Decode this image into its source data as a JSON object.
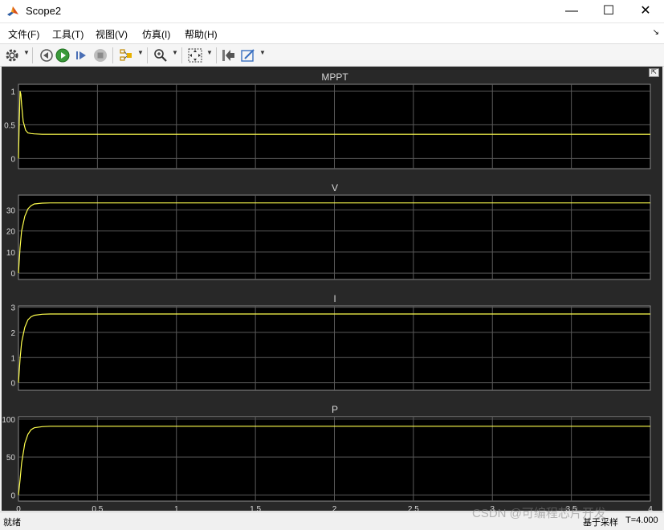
{
  "window": {
    "title": "Scope2",
    "minimize_glyph": "—",
    "maximize_glyph": "☐",
    "close_glyph": "✕"
  },
  "menu": {
    "items": [
      "文件(F)",
      "工具(T)",
      "视图(V)",
      "仿真(I)",
      "帮助(H)"
    ],
    "overflow_glyph": "↘"
  },
  "toolbar": {
    "icons": [
      "settings-icon",
      "step-back-icon",
      "run-icon",
      "step-forward-icon",
      "stop-icon",
      "signal-selector-icon",
      "zoom-icon",
      "autoscale-icon",
      "highlight-block-icon",
      "style-icon"
    ]
  },
  "plots": [
    {
      "title": "MPPT",
      "ylim": [
        -0.15,
        1.1
      ],
      "yticks": [
        "0",
        "0.5",
        "1"
      ],
      "ytick_values": [
        0,
        0.5,
        1
      ]
    },
    {
      "title": "V",
      "ylim": [
        -3,
        37
      ],
      "yticks": [
        "0",
        "10",
        "20",
        "30"
      ],
      "ytick_values": [
        0,
        10,
        20,
        30
      ]
    },
    {
      "title": "I",
      "ylim": [
        -0.3,
        3.05
      ],
      "yticks": [
        "0",
        "1",
        "2",
        "3"
      ],
      "ytick_values": [
        0,
        1,
        2,
        3
      ]
    },
    {
      "title": "P",
      "ylim": [
        -8,
        103
      ],
      "yticks": [
        "0",
        "50",
        "100"
      ],
      "ytick_values": [
        0,
        50,
        100
      ]
    }
  ],
  "xaxis": {
    "xlim": [
      0,
      4
    ],
    "ticks": [
      "0",
      "0.5",
      "1",
      "1.5",
      "2",
      "2.5",
      "3",
      "3.5",
      "4"
    ],
    "tick_values": [
      0,
      0.5,
      1,
      1.5,
      2,
      2.5,
      3,
      3.5,
      4
    ]
  },
  "chart_data": [
    {
      "type": "line",
      "title": "MPPT",
      "series": [
        {
          "x": [
            0,
            0.005,
            0.01,
            0.015,
            0.02,
            0.03,
            0.045,
            0.06,
            0.08,
            0.1,
            0.15,
            0.3,
            1,
            2,
            3,
            4
          ],
          "y": [
            0,
            0.55,
            1.0,
            0.95,
            0.8,
            0.55,
            0.42,
            0.38,
            0.37,
            0.365,
            0.36,
            0.36,
            0.36,
            0.36,
            0.36,
            0.36
          ]
        }
      ],
      "ylim": [
        -0.15,
        1.1
      ],
      "xlim": [
        0,
        4
      ],
      "grid": true,
      "color": "#ffff4d"
    },
    {
      "type": "line",
      "title": "V",
      "series": [
        {
          "x": [
            0,
            0.01,
            0.02,
            0.04,
            0.06,
            0.08,
            0.1,
            0.15,
            0.2,
            0.3,
            1,
            2,
            3,
            4
          ],
          "y": [
            0,
            12,
            20,
            27,
            30.5,
            32,
            32.8,
            33.2,
            33.3,
            33.3,
            33.3,
            33.3,
            33.3,
            33.3
          ]
        }
      ],
      "ylim": [
        -3,
        37
      ],
      "xlim": [
        0,
        4
      ],
      "grid": true,
      "color": "#ffff4d"
    },
    {
      "type": "line",
      "title": "I",
      "series": [
        {
          "x": [
            0,
            0.01,
            0.02,
            0.04,
            0.06,
            0.08,
            0.1,
            0.15,
            0.2,
            0.3,
            1,
            2,
            3,
            4
          ],
          "y": [
            0,
            0.95,
            1.6,
            2.2,
            2.5,
            2.62,
            2.68,
            2.72,
            2.73,
            2.73,
            2.73,
            2.73,
            2.73,
            2.73
          ]
        }
      ],
      "ylim": [
        -0.3,
        3.05
      ],
      "xlim": [
        0,
        4
      ],
      "grid": true,
      "color": "#ffff4d"
    },
    {
      "type": "line",
      "title": "P",
      "series": [
        {
          "x": [
            0,
            0.01,
            0.02,
            0.04,
            0.06,
            0.08,
            0.1,
            0.15,
            0.2,
            0.3,
            1,
            2,
            3,
            4
          ],
          "y": [
            0,
            20,
            42,
            68,
            80,
            86,
            88.5,
            90,
            90.5,
            90.5,
            90.5,
            90.5,
            90.5,
            90.5
          ]
        }
      ],
      "ylim": [
        -8,
        103
      ],
      "xlim": [
        0,
        4
      ],
      "grid": true,
      "color": "#ffff4d"
    }
  ],
  "status": {
    "left": "就绪",
    "sampling": "基于采样",
    "time": "T=4.000"
  },
  "watermark": "CSDN @可编程芯片开发",
  "colors": {
    "background": "#282828",
    "axes": "#000000",
    "grid": "#5a5a5a",
    "trace": "#ffff4d",
    "text": "#d9d9d9"
  }
}
